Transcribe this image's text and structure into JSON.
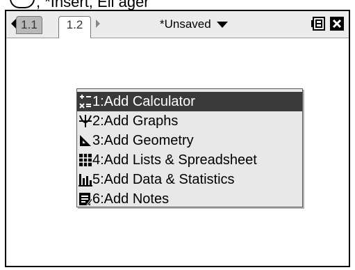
{
  "caption": {
    "text": ", *Insert, Ell ager"
  },
  "tabs": [
    {
      "label": "1.1"
    },
    {
      "label": "1.2"
    }
  ],
  "doc_title": "*Unsaved",
  "menu": {
    "items": [
      {
        "label": "1:Add Calculator",
        "icon": "calculator-icon",
        "selected": true
      },
      {
        "label": "2:Add Graphs",
        "icon": "graphs-icon",
        "selected": false
      },
      {
        "label": "3:Add Geometry",
        "icon": "geometry-icon",
        "selected": false
      },
      {
        "label": "4:Add Lists & Spreadsheet",
        "icon": "spreadsheet-icon",
        "selected": false
      },
      {
        "label": "5:Add Data & Statistics",
        "icon": "statistics-icon",
        "selected": false
      },
      {
        "label": "6:Add Notes",
        "icon": "notes-icon",
        "selected": false
      }
    ]
  },
  "colors": {
    "selected_bg": "#3a3a3a",
    "toolbar_bg": "#ececec",
    "menu_bg": "#e8e8e8"
  }
}
